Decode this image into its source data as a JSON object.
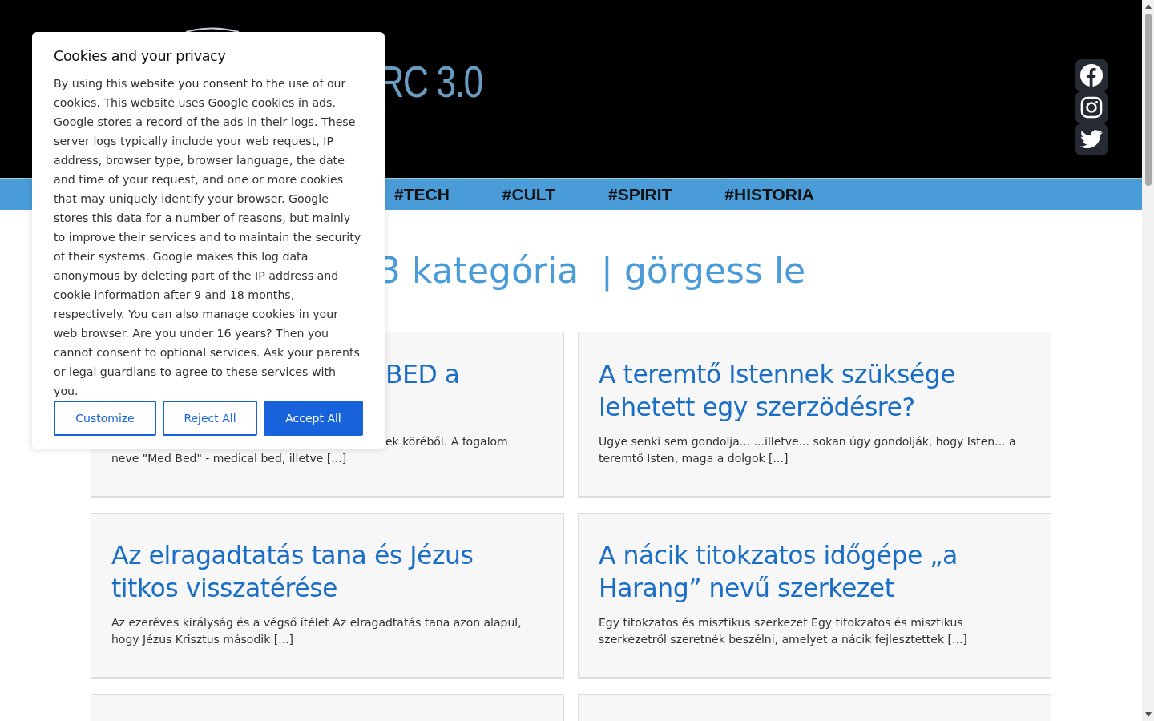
{
  "header": {
    "logo_text": "RC 3.0",
    "social": [
      {
        "kind": "facebook"
      },
      {
        "kind": "instagram"
      },
      {
        "kind": "twitter"
      }
    ]
  },
  "nav": {
    "items": [
      "#TECH",
      "#CULT",
      "#SPIRIT",
      "#HISTORIA"
    ]
  },
  "heading": "3 kategória  | görgess le",
  "cards": [
    {
      "partly_hidden": true,
      "title": "BED a",
      "excerpt": [
        "ek köréből. A fogalom",
        "neve \"Med Bed\" -  medical bed, illetve [...]"
      ]
    },
    {
      "partly_hidden": false,
      "title": "A teremtő Istennek szüksége lehetett egy szerzödésre?",
      "excerpt": [
        "Ugye senki sem gondolja... ...illetve... sokan úgy gondolják, hogy Isten... a teremtő Isten, maga a dolgok [...]"
      ]
    },
    {
      "partly_hidden": false,
      "title": "Az elragadtatás tana és Jézus titkos visszatérése",
      "excerpt": [
        "Az ezeréves királyság és a végső ítélet Az elragadtatás tana azon alapul, hogy Jézus Krisztus második [...]"
      ]
    },
    {
      "partly_hidden": false,
      "title": "A nácik titokzatos időgépe „a Harang” nevű szerkezet",
      "excerpt": [
        "Egy titokzatos és misztikus szerkezet Egy titokzatos és misztikus szerkezetről szeretnék beszélni, amelyet a nácik fejlesztettek [...]"
      ]
    }
  ],
  "cookie_dialog": {
    "title": "Cookies and your privacy",
    "text": "By using this website you consent to the use of our cookies. This website uses Google cookies in ads. Google stores a record of the ads in their logs. These server logs typically include your web request, IP address, browser type, browser language, the date and time of your request, and one or more cookies that may uniquely identify your browser. Google stores this data for a number of reasons, but mainly to improve their services and to maintain the security of their systems. Google makes this log data anonymous by deleting part of the IP address and cookie information after 9 and 18 months, respectively. You can also manage cookies in your web browser. Are you under 16 years? Then you cannot consent to optional services. Ask your parents or legal guardians to agree to these services with you.",
    "buttons": [
      {
        "label": "Customize",
        "kind": "outline"
      },
      {
        "label": "Reject All",
        "kind": "outline"
      },
      {
        "label": "Accept All",
        "kind": "primary"
      }
    ]
  }
}
